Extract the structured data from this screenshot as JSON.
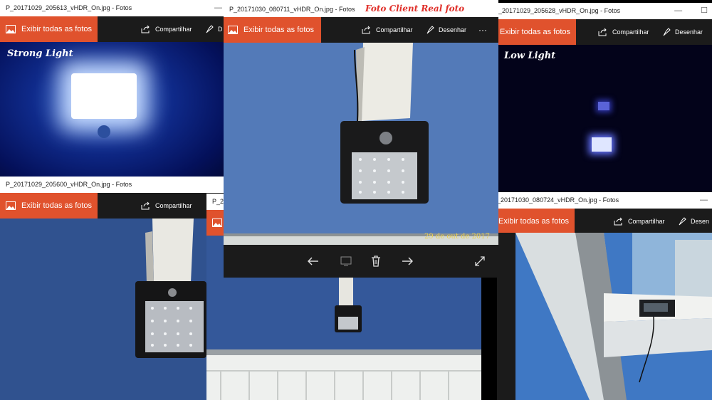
{
  "windows": {
    "w1": {
      "title": "P_20171029_205613_vHDR_On.jpg - Fotos",
      "caption": "Strong Light"
    },
    "w2": {
      "title": "P_20171030_080711_vHDR_On.jpg - Fotos",
      "overlay": "Foto Client Real foto",
      "timestamp": "29 de out de 2017"
    },
    "w3": {
      "title": "P_20171029_205628_vHDR_On.jpg - Fotos",
      "caption": "Low Light"
    },
    "w4": {
      "title": "P_20171029_205600_vHDR_On.jpg - Fotos"
    },
    "w5": {
      "title": "P_2"
    },
    "w6": {
      "title": "P_20171030_080724_vHDR_On.jpg - Fotos"
    }
  },
  "toolbar": {
    "show_all": "Exibir todas as fotos",
    "share": "Compartilhar",
    "draw": "Desenhar",
    "draw_short": "D",
    "draw_clipped": "Desen",
    "more": "···"
  },
  "icons": [
    "image-icon",
    "share-icon",
    "pen-icon",
    "arrow-left-icon",
    "arrow-right-icon",
    "delete-icon",
    "expand-icon",
    "slideshow-icon"
  ],
  "colors": {
    "accent": "#e0522d",
    "chrome": "#1b1b1b",
    "title_overlay": "#e0302a"
  }
}
